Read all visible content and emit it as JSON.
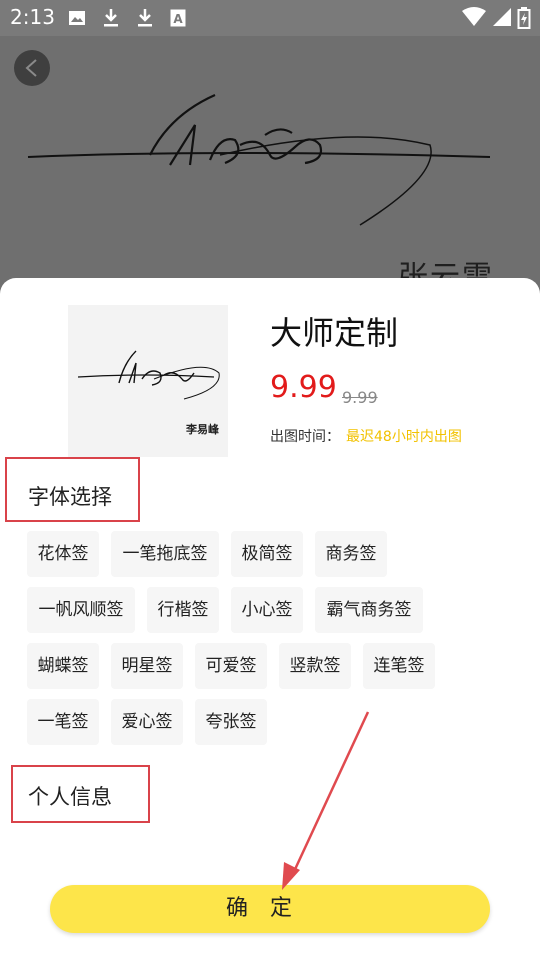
{
  "status_bar": {
    "time": "2:13",
    "icons": [
      "image-icon",
      "download-icon",
      "download-icon",
      "font-icon"
    ],
    "right_icons": [
      "wifi-icon",
      "signal-icon",
      "battery-icon"
    ]
  },
  "background": {
    "back_icon": "chevron-left-icon",
    "signature_name": "张云雷"
  },
  "product": {
    "title": "大师定制",
    "price": "9.99",
    "original_price": "9.99",
    "delivery_label": "出图时间：",
    "delivery_value": "最迟48小时内出图",
    "thumbnail_name": "李易峰"
  },
  "font_section": {
    "title": "字体选择",
    "options": [
      "花体签",
      "一笔拖底签",
      "极简签",
      "商务签",
      "一帆风顺签",
      "行楷签",
      "小心签",
      "霸气商务签",
      "蝴蝶签",
      "明星签",
      "可爱签",
      "竖款签",
      "连笔签",
      "一笔签",
      "爱心签",
      "夸张签"
    ]
  },
  "personal_section": {
    "title": "个人信息"
  },
  "confirm_button": {
    "label": "确定"
  },
  "colors": {
    "accent_yellow": "#fde54a",
    "price_red": "#e21b1b",
    "highlight_red": "#d9434a",
    "delivery_yellow": "#f2c200"
  }
}
